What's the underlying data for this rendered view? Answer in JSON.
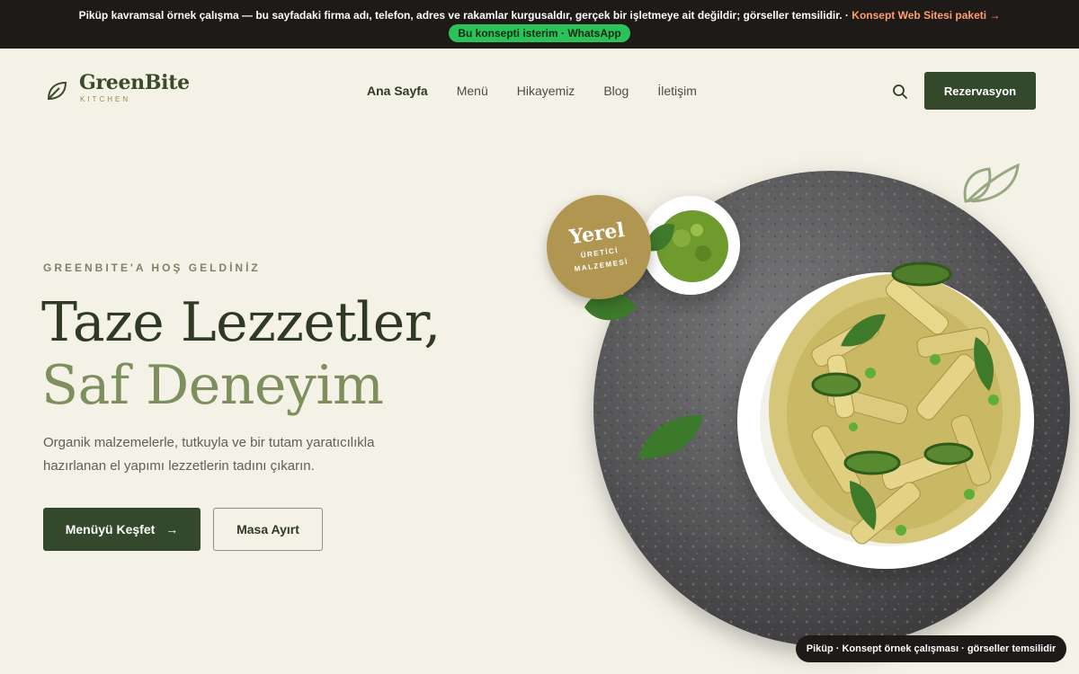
{
  "notice": {
    "text": "Piküp kavramsal örnek çalışma — bu sayfadaki firma adı, telefon, adres ve rakamlar kurgusaldır, gerçek bir işletmeye ait değildir; görseller temsilidir. ·",
    "link": "Konsept Web Sitesi paketi →",
    "whatsapp": "Bu konsepti isterim · WhatsApp"
  },
  "brand": {
    "name": "GreenBite",
    "sub": "KITCHEN"
  },
  "nav": [
    {
      "label": "Ana Sayfa",
      "active": true
    },
    {
      "label": "Menü"
    },
    {
      "label": "Hikayemiz"
    },
    {
      "label": "Blog"
    },
    {
      "label": "İletişim"
    }
  ],
  "header": {
    "reserve": "Rezervasyon",
    "search_icon": "search-icon"
  },
  "hero": {
    "eyebrow": "GREENBITE'A HOŞ GELDİNİZ",
    "title_line1": "Taze Lezzetler,",
    "title_line2": "Saf Deneyim",
    "lede": "Organik malzemelerle, tutkuyla ve bir tutam yaratıcılıkla hazırlanan el yapımı lezzetlerin tadını çıkarın.",
    "primary_btn": "Menüyü Keşfet",
    "secondary_btn": "Masa Ayırt"
  },
  "badge": {
    "title": "Yerel",
    "line1": "ÜRETİCİ",
    "line2": "MALZEMESİ"
  },
  "footer_pill": "Piküp · Konsept örnek çalışması · görseller temsilidir",
  "colors": {
    "primary": "#34482b",
    "accent_olive": "#7d8f5c",
    "badge_gold": "#b09650",
    "background": "#f4f1e6"
  }
}
